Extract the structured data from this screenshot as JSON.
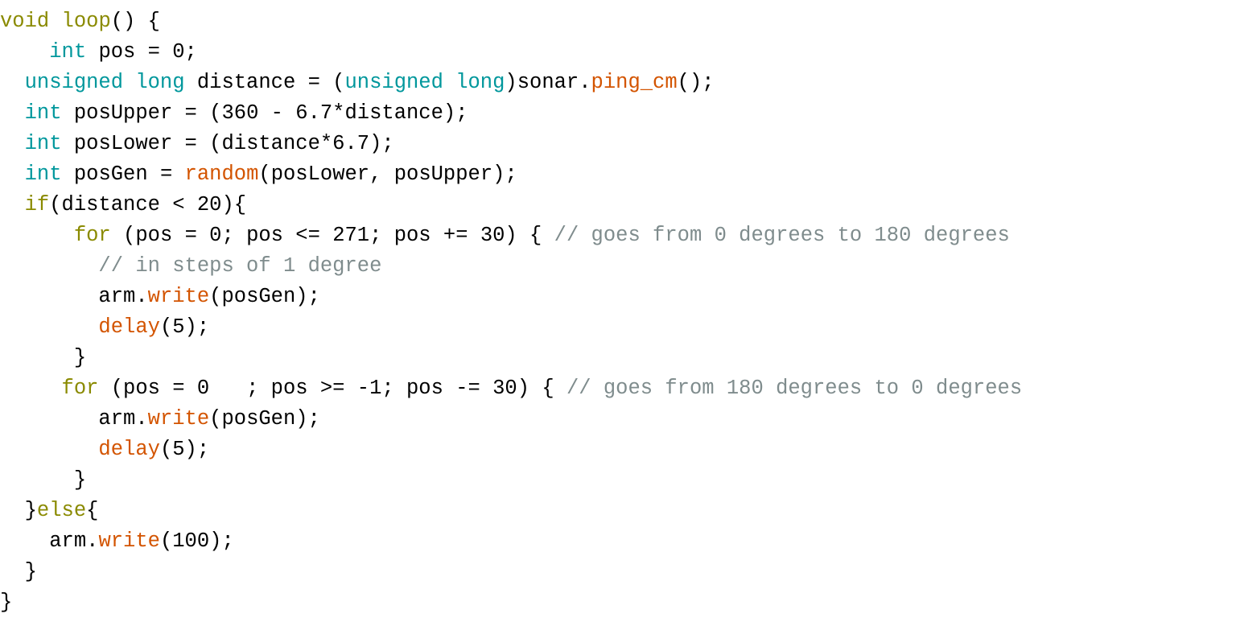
{
  "editor": {
    "language": "arduino-cpp",
    "background_color": "#ffffff",
    "default_text_color": "#000000",
    "theme_colors": {
      "keyword": "#8a8a00",
      "type": "#00979c",
      "function": "#d35400",
      "comment": "#7f8c8d",
      "plain": "#000000"
    }
  },
  "code": {
    "lines": [
      {
        "indent": 0,
        "tokens": [
          {
            "text": "void",
            "kind": "kw"
          },
          {
            "text": " ",
            "kind": "plain"
          },
          {
            "text": "loop",
            "kind": "kw"
          },
          {
            "text": "() {",
            "kind": "plain"
          }
        ]
      },
      {
        "indent": 4,
        "tokens": [
          {
            "text": "int",
            "kind": "type"
          },
          {
            "text": " pos = 0;",
            "kind": "plain"
          }
        ]
      },
      {
        "indent": 2,
        "tokens": [
          {
            "text": "unsigned long",
            "kind": "type"
          },
          {
            "text": " distance = (",
            "kind": "plain"
          },
          {
            "text": "unsigned long",
            "kind": "type"
          },
          {
            "text": ")sonar.",
            "kind": "plain"
          },
          {
            "text": "ping_cm",
            "kind": "fn"
          },
          {
            "text": "();",
            "kind": "plain"
          }
        ]
      },
      {
        "indent": 2,
        "tokens": [
          {
            "text": "int",
            "kind": "type"
          },
          {
            "text": " posUpper = (360 - 6.7*distance);",
            "kind": "plain"
          }
        ]
      },
      {
        "indent": 2,
        "tokens": [
          {
            "text": "int",
            "kind": "type"
          },
          {
            "text": " posLower = (distance*6.7);",
            "kind": "plain"
          }
        ]
      },
      {
        "indent": 2,
        "tokens": [
          {
            "text": "int",
            "kind": "type"
          },
          {
            "text": " posGen = ",
            "kind": "plain"
          },
          {
            "text": "random",
            "kind": "fn"
          },
          {
            "text": "(posLower, posUpper);",
            "kind": "plain"
          }
        ]
      },
      {
        "indent": 2,
        "tokens": [
          {
            "text": "if",
            "kind": "kw"
          },
          {
            "text": "(distance < 20){",
            "kind": "plain"
          }
        ]
      },
      {
        "indent": 6,
        "tokens": [
          {
            "text": "for",
            "kind": "kw"
          },
          {
            "text": " (pos = 0; pos <= 271; pos += 30) { ",
            "kind": "plain"
          },
          {
            "text": "// goes from 0 degrees to 180 degrees",
            "kind": "comment"
          }
        ]
      },
      {
        "indent": 8,
        "tokens": [
          {
            "text": "// in steps of 1 degree",
            "kind": "comment"
          }
        ]
      },
      {
        "indent": 8,
        "tokens": [
          {
            "text": "arm.",
            "kind": "plain"
          },
          {
            "text": "write",
            "kind": "fn"
          },
          {
            "text": "(posGen);",
            "kind": "plain"
          }
        ]
      },
      {
        "indent": 8,
        "tokens": [
          {
            "text": "delay",
            "kind": "fn"
          },
          {
            "text": "(5);",
            "kind": "plain"
          }
        ]
      },
      {
        "indent": 6,
        "tokens": [
          {
            "text": "}",
            "kind": "plain"
          }
        ]
      },
      {
        "indent": 5,
        "tokens": [
          {
            "text": "for",
            "kind": "kw"
          },
          {
            "text": " (pos = 0   ; pos >= -1; pos -= 30) { ",
            "kind": "plain"
          },
          {
            "text": "// goes from 180 degrees to 0 degrees",
            "kind": "comment"
          }
        ]
      },
      {
        "indent": 8,
        "tokens": [
          {
            "text": "arm.",
            "kind": "plain"
          },
          {
            "text": "write",
            "kind": "fn"
          },
          {
            "text": "(posGen);",
            "kind": "plain"
          }
        ]
      },
      {
        "indent": 8,
        "tokens": [
          {
            "text": "delay",
            "kind": "fn"
          },
          {
            "text": "(5);",
            "kind": "plain"
          }
        ]
      },
      {
        "indent": 6,
        "tokens": [
          {
            "text": "}",
            "kind": "plain"
          }
        ]
      },
      {
        "indent": 2,
        "tokens": [
          {
            "text": "}",
            "kind": "plain"
          },
          {
            "text": "else",
            "kind": "kw"
          },
          {
            "text": "{",
            "kind": "plain"
          }
        ]
      },
      {
        "indent": 4,
        "tokens": [
          {
            "text": "arm.",
            "kind": "plain"
          },
          {
            "text": "write",
            "kind": "fn"
          },
          {
            "text": "(100);",
            "kind": "plain"
          }
        ]
      },
      {
        "indent": 2,
        "tokens": [
          {
            "text": "}",
            "kind": "plain"
          }
        ]
      },
      {
        "indent": 0,
        "tokens": [
          {
            "text": "}",
            "kind": "plain"
          }
        ]
      }
    ]
  }
}
